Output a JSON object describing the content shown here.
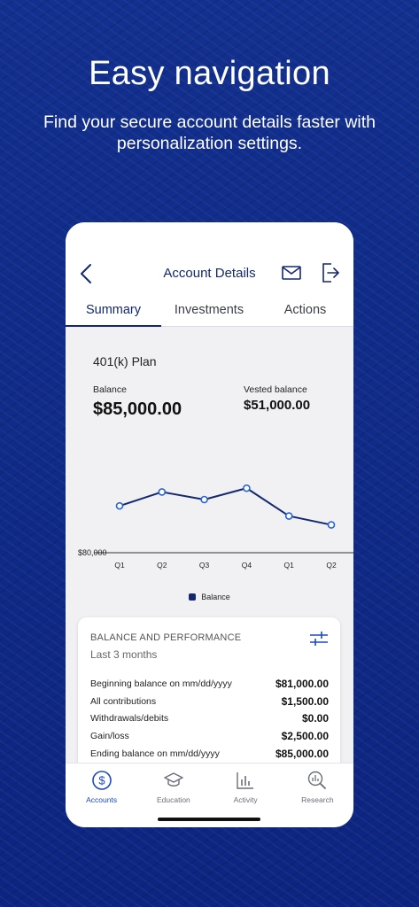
{
  "promo": {
    "headline": "Easy navigation",
    "subhead": "Find your secure account details faster with personalization settings."
  },
  "header": {
    "title": "Account Details",
    "back_icon": "chevron-left-icon",
    "mail_icon": "envelope-icon",
    "logout_icon": "logout-icon"
  },
  "tabs": [
    {
      "label": "Summary",
      "active": true
    },
    {
      "label": "Investments",
      "active": false
    },
    {
      "label": "Actions",
      "active": false
    }
  ],
  "summary": {
    "plan_name": "401(k) Plan",
    "balance_label": "Balance",
    "balance_value": "$85,000.00",
    "vested_label": "Vested balance",
    "vested_value": "$51,000.00"
  },
  "chart_data": {
    "type": "line",
    "categories": [
      "Q1",
      "Q2",
      "Q3",
      "Q4",
      "Q1",
      "Q2"
    ],
    "series": [
      {
        "name": "Balance",
        "values": [
          83700,
          84800,
          84200,
          85100,
          82900,
          82200
        ]
      }
    ],
    "ylabel_tick": "$80,000",
    "ylim": [
      80000,
      87000
    ],
    "color": "#13286e",
    "legend": "bottom"
  },
  "card": {
    "title": "BALANCE AND PERFORMANCE",
    "subtitle": "Last 3 months",
    "filter_icon": "sliders-icon",
    "rows": [
      {
        "label": "Beginning balance on mm/dd/yyyy",
        "value": "$81,000.00"
      },
      {
        "label": "All contributions",
        "value": "$1,500.00"
      },
      {
        "label": "Withdrawals/debits",
        "value": "$0.00"
      },
      {
        "label": "Gain/loss",
        "value": "$2,500.00"
      },
      {
        "label": "Ending balance on mm/dd/yyyy",
        "value": "$85,000.00"
      }
    ]
  },
  "bottom_nav": [
    {
      "label": "Accounts",
      "icon": "dollar-circle-icon",
      "active": true
    },
    {
      "label": "Education",
      "icon": "graduation-cap-icon",
      "active": false
    },
    {
      "label": "Activity",
      "icon": "bar-chart-icon",
      "active": false
    },
    {
      "label": "Research",
      "icon": "magnifier-chart-icon",
      "active": false
    }
  ],
  "colors": {
    "brand": "#13286e",
    "accent": "#1c48c6",
    "background": "#0f2a8a"
  }
}
